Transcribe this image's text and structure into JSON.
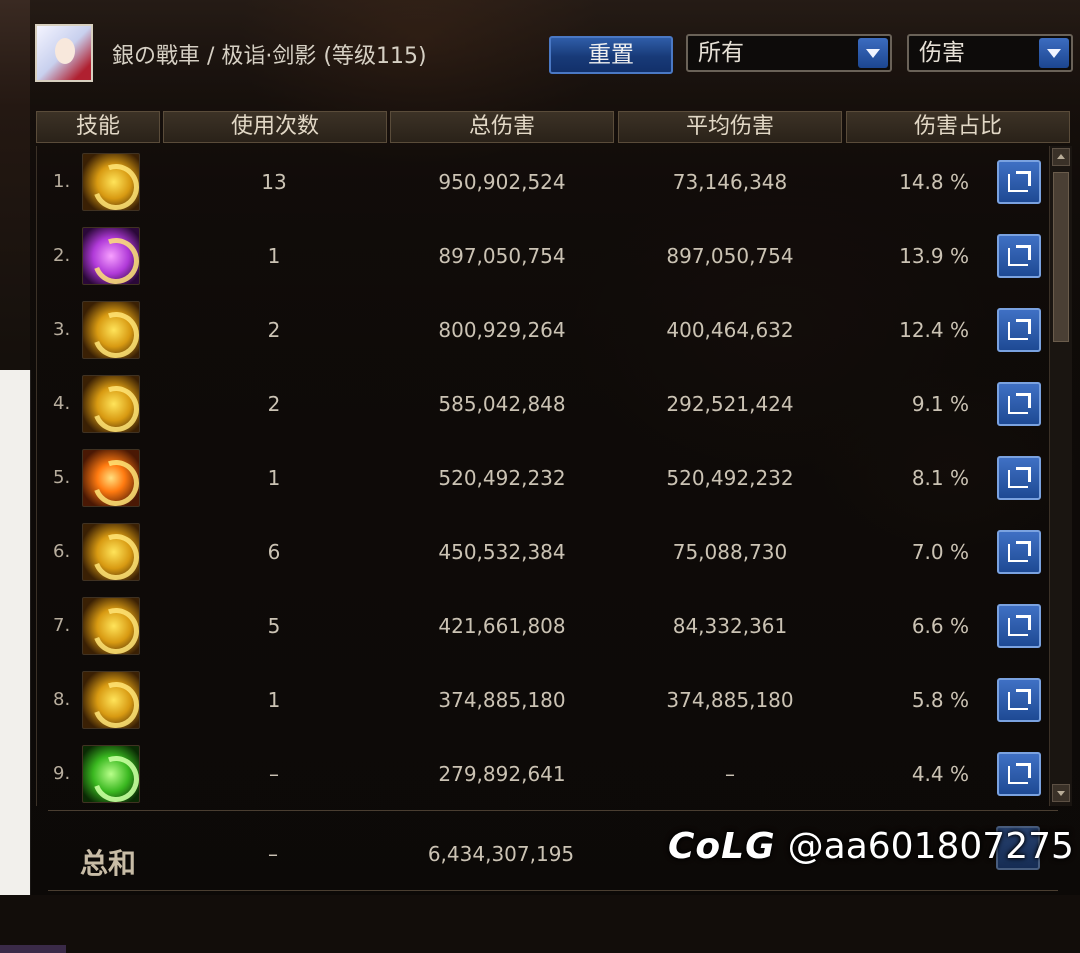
{
  "header": {
    "character": "銀の戰車 / 极诣·剑影 (等级115)",
    "reset_label": "重置",
    "filter_value": "所有",
    "metric_value": "伤害"
  },
  "columns": [
    "技能",
    "使用次数",
    "总伤害",
    "平均伤害",
    "伤害占比"
  ],
  "rows": [
    {
      "rank": "1.",
      "uses": "13",
      "total": "950,902,524",
      "avg": "73,146,348",
      "pct": "14.8 %",
      "icon": "gold-slash-skill-icon"
    },
    {
      "rank": "2.",
      "uses": "1",
      "total": "897,050,754",
      "avg": "897,050,754",
      "pct": "13.9 %",
      "icon": "purple-burst-skill-icon"
    },
    {
      "rank": "3.",
      "uses": "2",
      "total": "800,929,264",
      "avg": "400,464,632",
      "pct": "12.4 %",
      "icon": "gold-ring-skill-icon"
    },
    {
      "rank": "4.",
      "uses": "2",
      "total": "585,042,848",
      "avg": "292,521,424",
      "pct": "9.1 %",
      "icon": "gold-wave-skill-icon"
    },
    {
      "rank": "5.",
      "uses": "1",
      "total": "520,492,232",
      "avg": "520,492,232",
      "pct": "8.1 %",
      "icon": "orange-cross-skill-icon"
    },
    {
      "rank": "6.",
      "uses": "6",
      "total": "450,532,384",
      "avg": "75,088,730",
      "pct": "7.0 %",
      "icon": "gold-arc-skill-icon"
    },
    {
      "rank": "7.",
      "uses": "5",
      "total": "421,661,808",
      "avg": "84,332,361",
      "pct": "6.6 %",
      "icon": "gold-swirl-skill-icon"
    },
    {
      "rank": "8.",
      "uses": "1",
      "total": "374,885,180",
      "avg": "374,885,180",
      "pct": "5.8 %",
      "icon": "gold-glyph-skill-icon"
    },
    {
      "rank": "9.",
      "uses": "–",
      "total": "279,892,641",
      "avg": "–",
      "pct": "4.4 %",
      "icon": "green-ring-skill-icon"
    }
  ],
  "total": {
    "label": "总和",
    "uses": "–",
    "damage": "6,434,307,195"
  },
  "watermark": {
    "brand": "CoLG",
    "handle": "@aa601807275"
  },
  "colors": {
    "accent_blue": "#1e4a94",
    "panel_bg": "#120d0a",
    "text": "#cbc3b4"
  }
}
